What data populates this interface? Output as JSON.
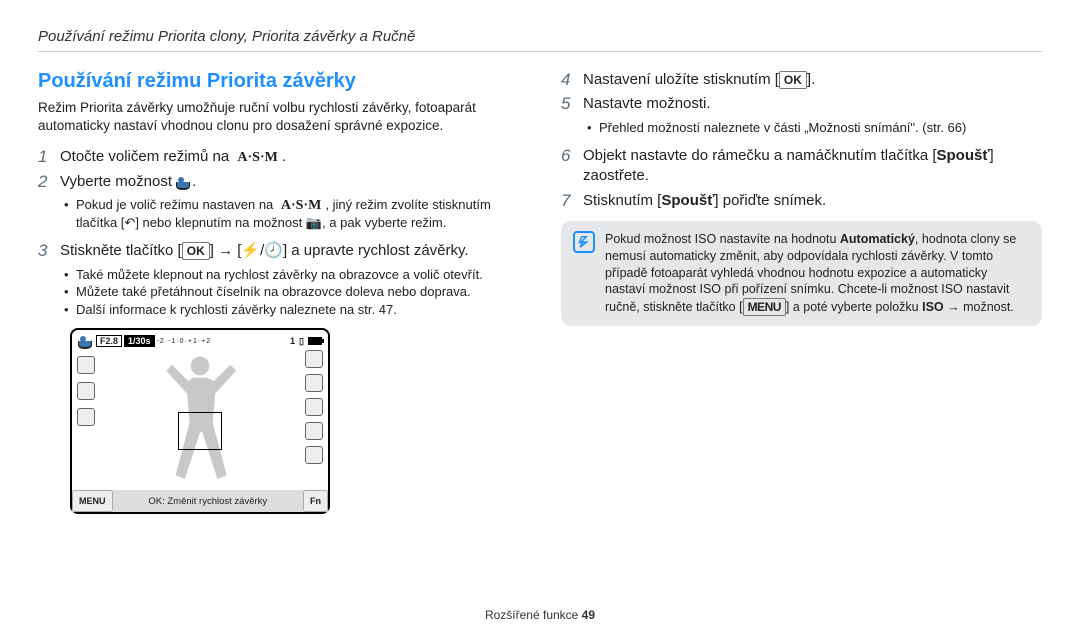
{
  "crumb": "Používání režimu Priorita clony, Priorita závěrky a Ručně",
  "heading": "Používání režimu Priorita závěrky",
  "intro": "Režim Priorita závěrky umožňuje ruční volbu rychlosti závěrky, fotoaparát automaticky nastaví vhodnou clonu pro dosažení správné expozice.",
  "st1_a": "Otočte voličem režimů na ",
  "st1_b": ".",
  "st2_a": "Vyberte možnost ",
  "st2_b": ".",
  "st2_sub_a": "Pokud je volič režimu nastaven na ",
  "st2_sub_b": ", jiný režim zvolíte stisknutím tlačítka [",
  "st2_sub_c": "] nebo klepnutím na možnost ",
  "st2_sub_d": ", a pak vyberte režim.",
  "st3_a": "Stiskněte tlačítko [",
  "st3_b": "] → [",
  "st3_c": "] a upravte rychlost závěrky.",
  "st3_sub": [
    "Také můžete klepnout na rychlost závěrky na obrazovce a volič otevřít.",
    "Můžete také přetáhnout číselník na obrazovce doleva nebo doprava.",
    "Další informace k rychlosti závěrky naleznete na str. 47."
  ],
  "st4_a": "Nastavení uložíte stisknutím [",
  "st4_b": "].",
  "st5": "Nastavte možnosti.",
  "st5_sub": "Přehled možností naleznete v části „Možnosti snímání\". (str. 66)",
  "st6_a": "Objekt nastavte do rámečku a namáčknutím tlačítka [",
  "st6_b": "Spoušť",
  "st6_c": "] zaostřete.",
  "st7_a": "Stisknutím [",
  "st7_b": "Spoušť",
  "st7_c": "] pořiďte snímek.",
  "note_a": "Pokud možnost ISO nastavíte na hodnotu ",
  "note_bold1": "Automatický",
  "note_b": ", hodnota clony se nemusí automaticky změnit, aby odpovídala rychlosti závěrky. V tomto případě fotoaparát vyhledá vhodnou hodnotu expozice a automaticky nastaví možnost ISO při pořízení snímku. Chcete-li možnost ISO nastavit ručně, stiskněte tlačítko [",
  "note_c": "] a poté vyberte položku ",
  "note_bold2": "ISO",
  "note_d": " → možnost.",
  "cam": {
    "f": "F2.8",
    "s": "1/30s",
    "count": "1",
    "menu": "MENU",
    "mid": "OK: Změnit rychlost závěrky",
    "fn": "Fn"
  },
  "footer_a": "Rozšířené funkce  ",
  "footer_b": "49",
  "ico": {
    "asm": "A·S·M",
    "ok": "OK",
    "menu": "MENU",
    "back": "↶",
    "cam": "📷",
    "flash": "⚡/🕗"
  }
}
